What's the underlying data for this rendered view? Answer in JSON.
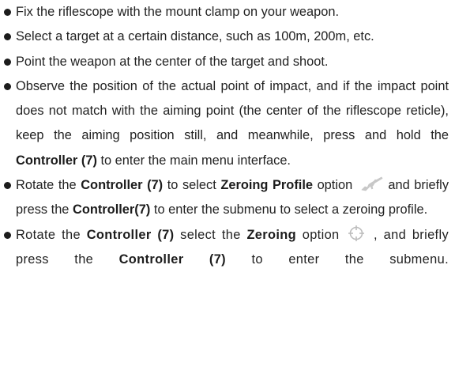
{
  "items": [
    {
      "text": "Fix the riflescope with the mount clamp on your weapon."
    },
    {
      "text": "Select a target at a certain distance, such as 100m, 200m, etc."
    },
    {
      "text": "Point the weapon at the center of the target and shoot."
    },
    {
      "text": "Observe the position of the actual point of impact, and if the impact point does not match with the aiming point (the center of the riflescope reticle), keep the aiming position still, and meanwhile, press and hold the ",
      "b1": "Controller (7)",
      "t2": " to enter the main menu interface."
    },
    {
      "t1": "Rotate the ",
      "b1": "Controller (7)",
      "t2": " to select ",
      "b2": "Zeroing Profile",
      "t3": " option",
      "t4": " and briefly press the ",
      "b3": "Controller(7)",
      "t5": " to enter the submenu to select a zeroing profile."
    },
    {
      "t1": "Rotate the ",
      "b1": "Controller (7)",
      "t2": " select the ",
      "b2": "Zeroing",
      "t3": " option",
      "t4": " , and briefly press the ",
      "b3": "Controller (7)",
      "t5": " to enter the submenu."
    }
  ],
  "icons": [
    "rifle-icon",
    "crosshair-icon"
  ],
  "colors": {
    "text": "#222222",
    "icon": "#c8c8c8"
  }
}
